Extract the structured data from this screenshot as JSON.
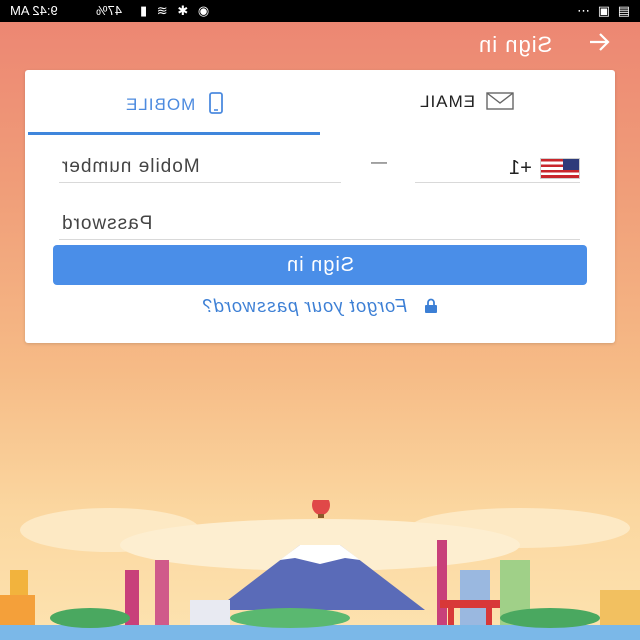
{
  "status_bar": {
    "time": "9:42 AM",
    "battery": "47%",
    "icons": [
      "battery-icon",
      "signal-icon",
      "wifi-icon",
      "bluetooth-icon",
      "location-icon",
      "menu-dots-icon",
      "image-icon",
      "message-icon"
    ]
  },
  "header": {
    "title": "Sign in",
    "back_icon": "arrow-left-icon"
  },
  "tabs": [
    {
      "label": "MOBILE",
      "icon": "phone-icon",
      "active": true
    },
    {
      "label": "EMAIL",
      "icon": "envelope-icon",
      "active": false
    }
  ],
  "form": {
    "country_code": "+1",
    "country_flag": "us-flag-icon",
    "mobile_placeholder": "Mobile number",
    "password_placeholder": "Password",
    "signin_label": "Sign in",
    "forgot_label": "Forgot your password?",
    "forgot_icon": "lock-icon"
  },
  "colors": {
    "accent": "#4a8ee8",
    "tab_active": "#4d8bdf",
    "link": "#3c7fd5",
    "header_bg_top": "#ec8472"
  }
}
